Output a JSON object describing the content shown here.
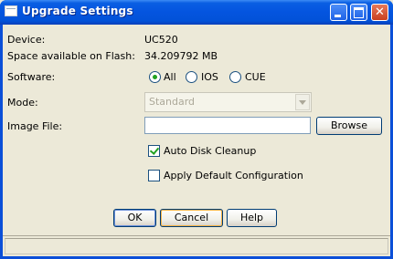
{
  "window": {
    "title": "Upgrade Settings",
    "close_glyph": "✕"
  },
  "info": {
    "device_label": "Device:",
    "device_value": "UC520",
    "space_label": "Space available on Flash:",
    "space_value": "34.209792 MB"
  },
  "software": {
    "label": "Software:",
    "options": [
      "All",
      "IOS",
      "CUE"
    ],
    "selected": "All"
  },
  "mode": {
    "label": "Mode:",
    "value": "Standard",
    "enabled": false
  },
  "image_file": {
    "label": "Image File:",
    "value": "",
    "browse_label": "Browse"
  },
  "checkboxes": {
    "auto_disk_cleanup": {
      "label": "Auto Disk Cleanup",
      "checked": true
    },
    "apply_default_config": {
      "label": "Apply Default Configuration",
      "checked": false
    }
  },
  "buttons": {
    "ok": "OK",
    "cancel": "Cancel",
    "help": "Help"
  },
  "colors": {
    "titlebar": "#0454df",
    "face": "#ece9d8",
    "accent_green": "#21a121"
  }
}
